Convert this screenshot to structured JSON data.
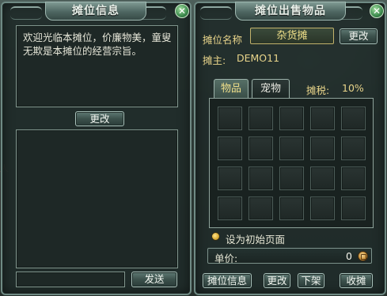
{
  "left_panel": {
    "title": "摊位信息",
    "close_symbol": "✕",
    "message": "欢迎光临本摊位，价廉物美，童叟无欺是本摊位的经营宗旨。",
    "edit_label": "更改",
    "send_label": "发送"
  },
  "right_panel": {
    "title": "摊位出售物品",
    "close_symbol": "✕",
    "stall_name_label": "摊位名称",
    "stall_name_value": "杂货摊",
    "edit_label": "更改",
    "owner_label": "摊主:",
    "owner_name": "DEMO11",
    "tabs": [
      {
        "label": "物品",
        "active": true
      },
      {
        "label": "宠物",
        "active": false
      }
    ],
    "tax_label": "摊税:",
    "tax_value": "10%",
    "grid": {
      "rows": 4,
      "cols": 5
    },
    "radio_label": "设为初始页面",
    "price_label": "单价:",
    "price_value": "0",
    "buttons": {
      "stall_info": "摊位信息",
      "edit": "更改",
      "take_down": "下架",
      "close_stall": "收摊"
    }
  },
  "colors": {
    "gold_text": "#e8d48a",
    "panel_border": "#6f8a84",
    "button_border": "#aac3bc"
  },
  "icons": {
    "close": "close-icon",
    "coin": "coin-icon",
    "radio": "radio-icon"
  }
}
